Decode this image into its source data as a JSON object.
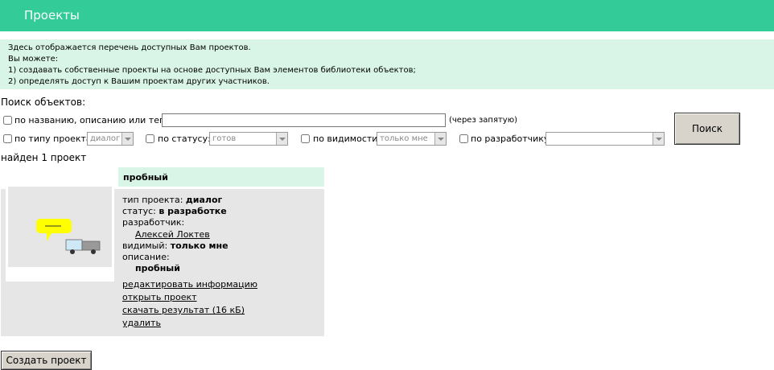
{
  "header": {
    "title": "Проекты"
  },
  "info": {
    "lines": [
      "Здесь отображается перечень доступных Вам проектов.",
      "Вы можете:",
      "1) создавать собственные проекты на основе доступных Вам элементов библиотеки объектов;",
      "2) определять доступ к Вашим проектам других участников."
    ]
  },
  "search": {
    "title": "Поиск объектов:",
    "by_name_label": "по названию, описанию или тегам:",
    "name_value": "",
    "comma_hint": "(через запятую)",
    "by_type_label": "по типу проекта:",
    "type_value": "диалог",
    "by_status_label": "по статусу:",
    "status_value": "готов",
    "by_visibility_label": "по видимости:",
    "visibility_value": "только мне",
    "by_developer_label": "по разработчику:",
    "developer_value": "",
    "button_label": "Поиск"
  },
  "results": {
    "found_text": "найден 1 проект",
    "projects": [
      {
        "title": "пробный",
        "type_label": "тип проекта:",
        "type_value": "диалог",
        "status_label": "статус:",
        "status_value": "в разработке",
        "developer_label": "разработчик:",
        "developer_name": "Алексей Локтев",
        "visible_label": "видимый:",
        "visible_value": "только мне",
        "description_label": "описание:",
        "description_value": "пробный",
        "links": {
          "edit": "редактировать информацию",
          "open": "открыть проект",
          "download": "скачать результат (16 кБ)",
          "delete": "удалить"
        }
      }
    ]
  },
  "footer": {
    "create_button": "Создать проект"
  },
  "colors": {
    "header_bg": "#33cc99",
    "info_bg": "#d9f5e7",
    "card_bg": "#e6e6e6",
    "bubble": "#ffff00"
  }
}
